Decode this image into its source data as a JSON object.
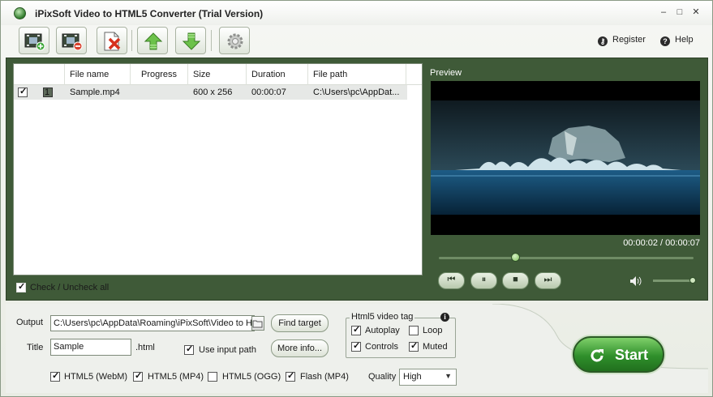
{
  "window": {
    "title": "iPixSoft Video to HTML5 Converter (Trial Version)",
    "controls": {
      "minimize": "–",
      "maximize": "□",
      "close": "✕"
    }
  },
  "toolbar": {
    "buttons": [
      {
        "icon": "add-video-icon"
      },
      {
        "icon": "remove-video-icon"
      },
      {
        "icon": "clear-list-icon"
      },
      {
        "icon": "move-up-icon"
      },
      {
        "icon": "move-down-icon"
      },
      {
        "icon": "settings-gear-icon"
      }
    ],
    "register_label": "Register",
    "help_label": "Help"
  },
  "file_list": {
    "columns": [
      "File name",
      "Progress",
      "Size",
      "Duration",
      "File path"
    ],
    "rows": [
      {
        "checked": true,
        "index": "1",
        "file_name": "Sample.mp4",
        "progress": "",
        "size": "600 x 256",
        "duration": "00:00:07",
        "file_path": "C:\\Users\\pc\\AppDat..."
      }
    ],
    "check_all_label": "Check / Uncheck all",
    "check_all_checked": true
  },
  "preview": {
    "label": "Preview",
    "timecode": "00:00:02 / 00:00:07",
    "position_fraction": 0.3,
    "volume_fraction": 1.0,
    "buttons": [
      "previous",
      "pause",
      "stop",
      "next"
    ]
  },
  "output": {
    "output_label": "Output",
    "output_path": "C:\\Users\\pc\\AppData\\Roaming\\iPixSoft\\Video to HT",
    "find_target_label": "Find target",
    "title_label": "Title",
    "title_value": "Sample",
    "html_ext": ".html",
    "use_input_path_label": "Use input path",
    "use_input_path_checked": true,
    "more_info_label": "More info...",
    "html5_tag": {
      "title": "Html5 video tag",
      "autoplay": {
        "label": "Autoplay",
        "checked": true
      },
      "loop": {
        "label": "Loop",
        "checked": false
      },
      "controls": {
        "label": "Controls",
        "checked": true
      },
      "muted": {
        "label": "Muted",
        "checked": true
      }
    },
    "formats": [
      {
        "label": "HTML5 (WebM)",
        "checked": true
      },
      {
        "label": "HTML5 (MP4)",
        "checked": true
      },
      {
        "label": "HTML5 (OGG)",
        "checked": false
      },
      {
        "label": "Flash (MP4)",
        "checked": true
      }
    ],
    "quality_label": "Quality",
    "quality_value": "High",
    "start_label": "Start"
  },
  "colors": {
    "panel_green": "#3f5a38",
    "start_green": "#2f8f2b"
  }
}
